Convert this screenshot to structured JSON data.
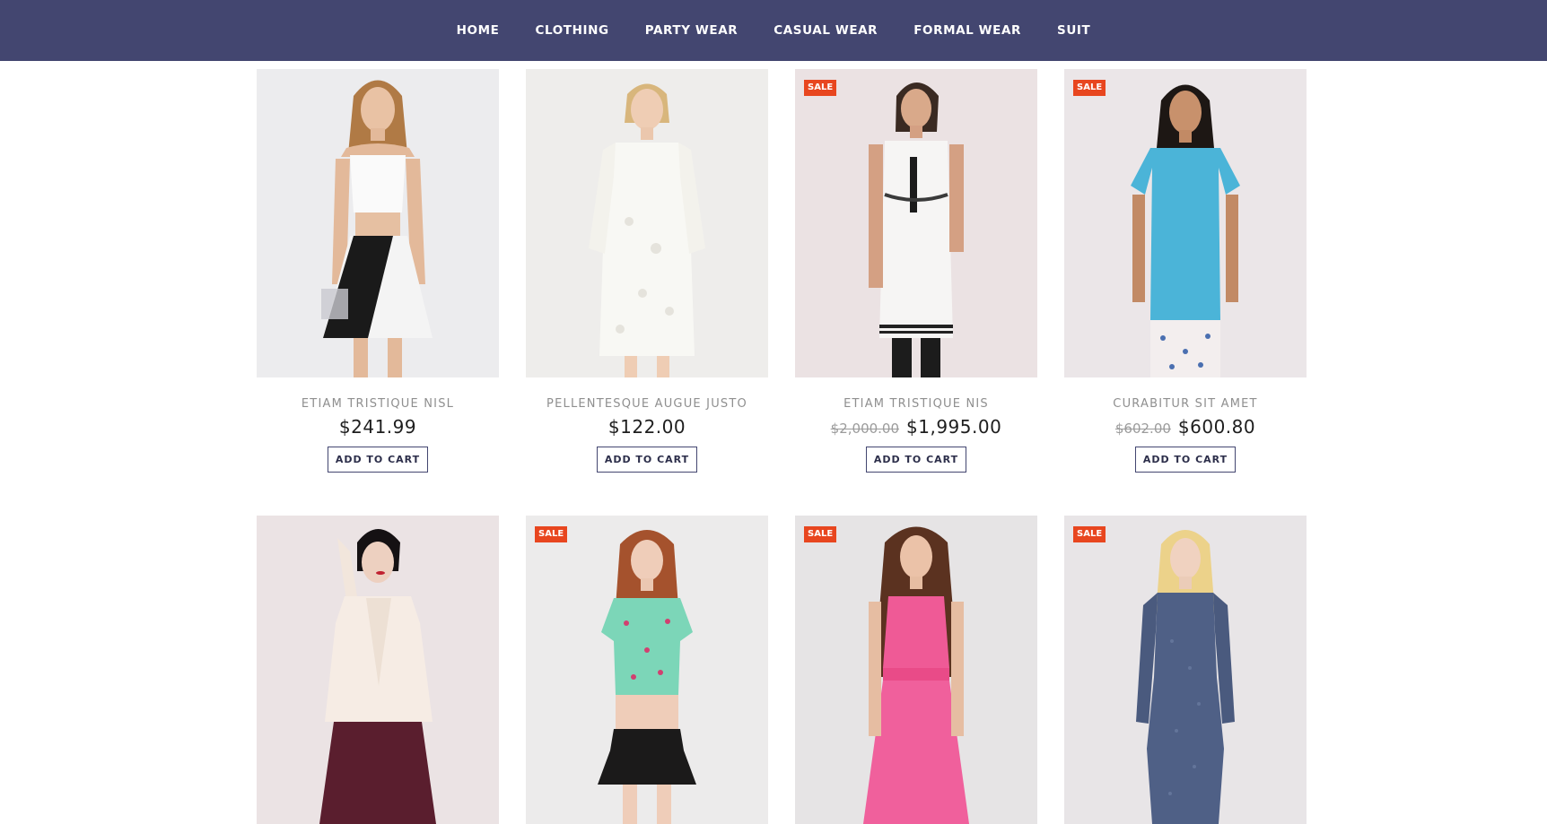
{
  "nav": {
    "items": [
      "HOME",
      "CLOTHING",
      "PARTY WEAR",
      "CASUAL WEAR",
      "FORMAL WEAR",
      "SUIT"
    ]
  },
  "colors": {
    "nav_bg": "#434670",
    "sale_badge": "#e8461f"
  },
  "products": [
    {
      "name": "ETIAM TRISTIQUE NISL",
      "price": "$241.99",
      "old_price": "",
      "sale": false,
      "sale_label": "",
      "cart_label": "ADD TO CART"
    },
    {
      "name": "PELLENTESQUE AUGUE JUSTO",
      "price": "$122.00",
      "old_price": "",
      "sale": false,
      "sale_label": "",
      "cart_label": "ADD TO CART"
    },
    {
      "name": "ETIAM TRISTIQUE NIS",
      "price": "$1,995.00",
      "old_price": "$2,000.00",
      "sale": true,
      "sale_label": "SALE",
      "cart_label": "ADD TO CART"
    },
    {
      "name": "CURABITUR SIT AMET",
      "price": "$600.80",
      "old_price": "$602.00",
      "sale": true,
      "sale_label": "SALE",
      "cart_label": "ADD TO CART"
    },
    {
      "name": "",
      "price": "",
      "old_price": "",
      "sale": false,
      "sale_label": ""
    },
    {
      "name": "",
      "price": "",
      "old_price": "",
      "sale": true,
      "sale_label": "SALE"
    },
    {
      "name": "",
      "price": "",
      "old_price": "",
      "sale": true,
      "sale_label": "SALE"
    },
    {
      "name": "",
      "price": "",
      "old_price": "",
      "sale": true,
      "sale_label": "SALE"
    }
  ]
}
